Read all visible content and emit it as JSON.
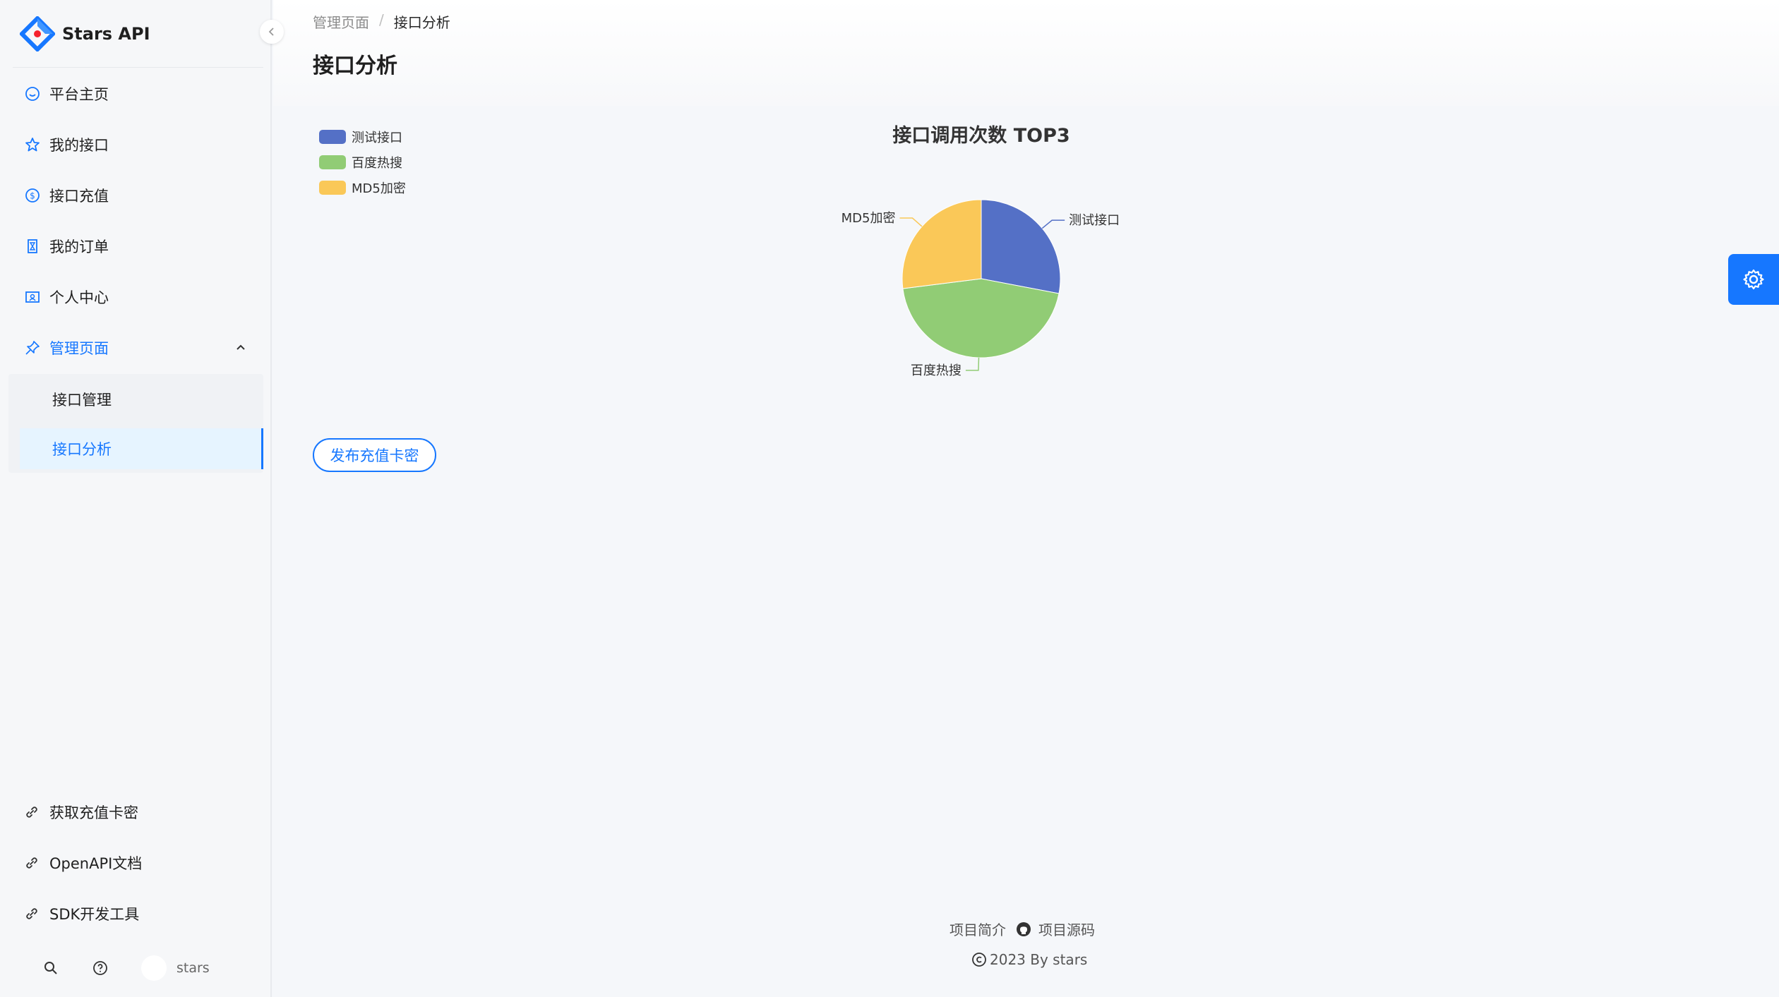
{
  "brand": {
    "title": "Stars API"
  },
  "sidebar": {
    "items": [
      {
        "label": "平台主页",
        "icon": "smile-icon"
      },
      {
        "label": "我的接口",
        "icon": "star-icon"
      },
      {
        "label": "接口充值",
        "icon": "dollar-icon"
      },
      {
        "label": "我的订单",
        "icon": "hourglass-icon"
      },
      {
        "label": "个人中心",
        "icon": "idcard-icon"
      },
      {
        "label": "管理页面",
        "icon": "pushpin-icon",
        "expanded": true
      }
    ],
    "sub_items": [
      {
        "label": "接口管理"
      },
      {
        "label": "接口分析",
        "selected": true
      }
    ],
    "links": [
      {
        "label": "获取充值卡密",
        "icon": "link-icon"
      },
      {
        "label": "OpenAPI文档",
        "icon": "link-icon"
      },
      {
        "label": "SDK开发工具",
        "icon": "link-icon"
      }
    ],
    "user": {
      "name": "stars"
    }
  },
  "breadcrumb": {
    "parent": "管理页面",
    "separator": "/",
    "current": "接口分析"
  },
  "page": {
    "title": "接口分析"
  },
  "actions": {
    "publish_label": "发布充值卡密"
  },
  "footer": {
    "intro": "项目简介",
    "source": "项目源码",
    "copyright": "2023 By stars"
  },
  "colors": {
    "accent": "#1677ff",
    "series": [
      "#5470c6",
      "#91cc75",
      "#fac858"
    ]
  },
  "chart_data": {
    "type": "pie",
    "title": "接口调用次数 TOP3",
    "legend_position": "top-left",
    "categories": [
      "测试接口",
      "百度热搜",
      "MD5加密"
    ],
    "values": [
      28,
      45,
      27
    ]
  }
}
